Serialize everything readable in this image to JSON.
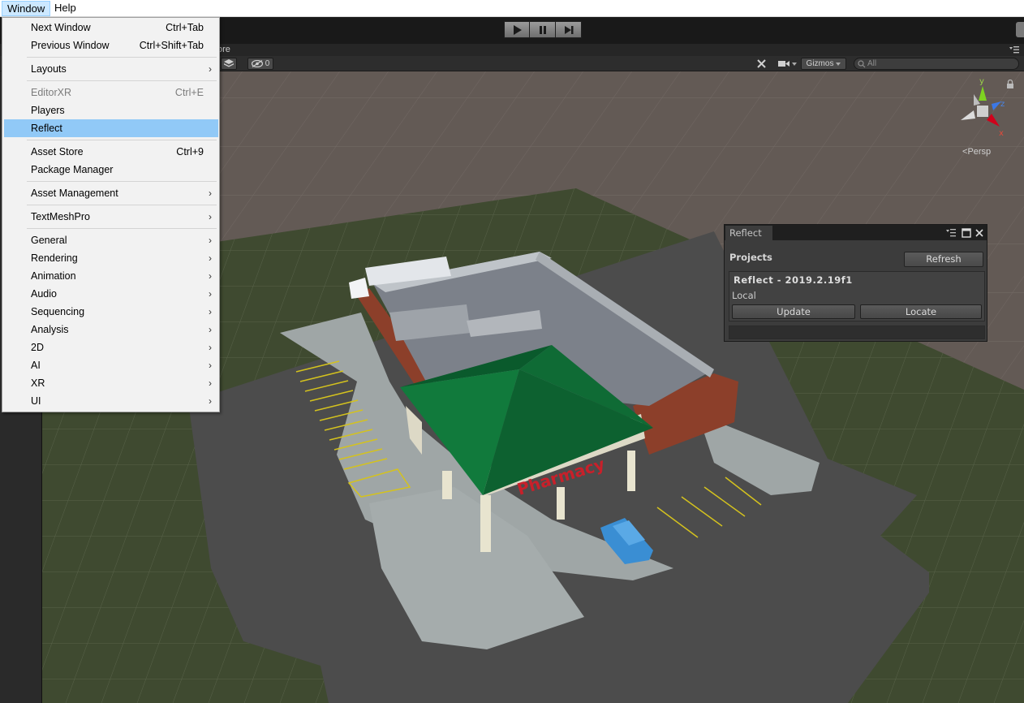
{
  "menubar": {
    "window": "Window",
    "help": "Help"
  },
  "toolbar": {
    "play_icon": "play-icon",
    "pause_icon": "pause-icon",
    "step_icon": "step-icon"
  },
  "scene_tab": {
    "label": "ore"
  },
  "scene_toolbar": {
    "hidden_count": "0",
    "gizmos": "Gizmos",
    "search_placeholder": "All",
    "persp": "Persp",
    "axes": {
      "y": "y",
      "z": "z",
      "x": "x"
    }
  },
  "window_menu": {
    "next_window": {
      "label": "Next Window",
      "shortcut": "Ctrl+Tab"
    },
    "previous_window": {
      "label": "Previous Window",
      "shortcut": "Ctrl+Shift+Tab"
    },
    "layouts": {
      "label": "Layouts"
    },
    "editorxr": {
      "label": "EditorXR",
      "shortcut": "Ctrl+E"
    },
    "players": {
      "label": "Players"
    },
    "reflect": {
      "label": "Reflect"
    },
    "asset_store": {
      "label": "Asset Store",
      "shortcut": "Ctrl+9"
    },
    "package_manager": {
      "label": "Package Manager"
    },
    "asset_management": {
      "label": "Asset Management"
    },
    "textmeshpro": {
      "label": "TextMeshPro"
    },
    "general": {
      "label": "General"
    },
    "rendering": {
      "label": "Rendering"
    },
    "animation": {
      "label": "Animation"
    },
    "audio": {
      "label": "Audio"
    },
    "sequencing": {
      "label": "Sequencing"
    },
    "analysis": {
      "label": "Analysis"
    },
    "2d": {
      "label": "2D"
    },
    "ai": {
      "label": "AI"
    },
    "xr": {
      "label": "XR"
    },
    "ui": {
      "label": "UI"
    },
    "submenu_arrow": "›"
  },
  "reflect_window": {
    "tab": "Reflect",
    "projects_label": "Projects",
    "refresh": "Refresh",
    "project": {
      "name": "Reflect - 2019.2.19f1",
      "location": "Local"
    },
    "update": "Update",
    "locate": "Locate"
  },
  "scene_content": {
    "sign_text": "Pharmacy"
  },
  "colors": {
    "menu_highlight": "#91c9f7",
    "roof_green": "#0f6b35",
    "sign_red": "#c8202a"
  }
}
